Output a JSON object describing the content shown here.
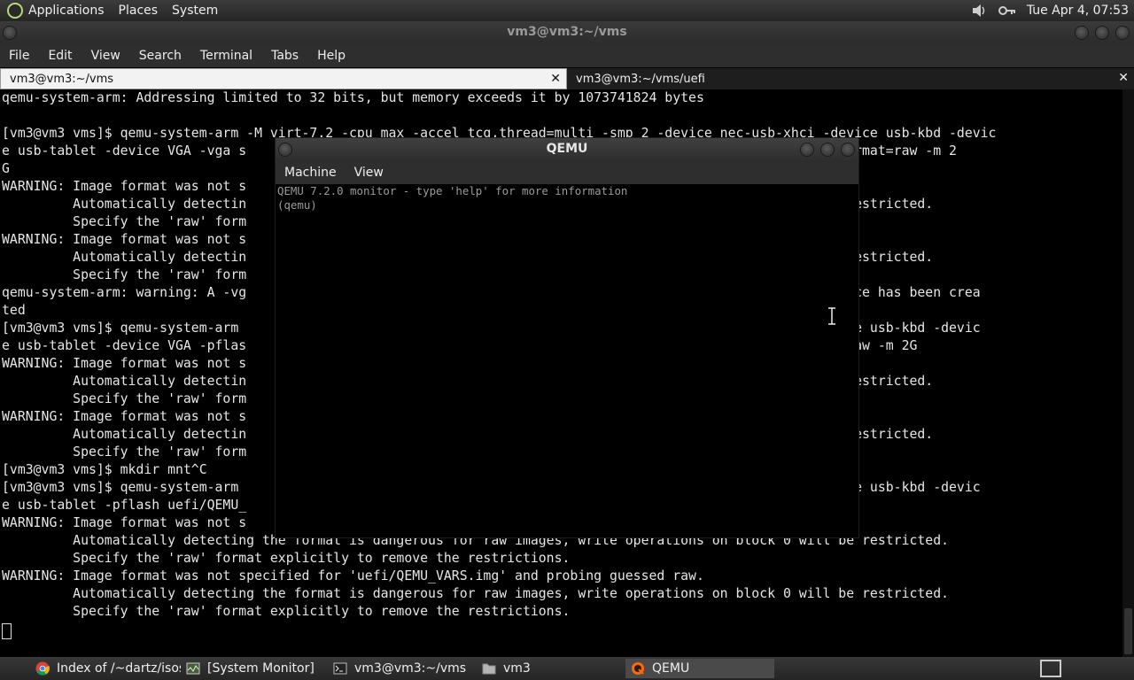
{
  "top_panel": {
    "menus": [
      "Applications",
      "Places",
      "System"
    ],
    "clock": "Tue Apr  4, 07:53",
    "tray_icons": [
      "volume-icon",
      "network-key-icon"
    ]
  },
  "terminal_window": {
    "title": "vm3@vm3:~/vms",
    "menus": [
      "File",
      "Edit",
      "View",
      "Search",
      "Terminal",
      "Tabs",
      "Help"
    ],
    "tabs": [
      {
        "label": "vm3@vm3:~/vms",
        "active": true
      },
      {
        "label": "vm3@vm3:~/vms/uefi",
        "active": false
      }
    ],
    "lines": [
      "qemu-system-arm: Addressing limited to 32 bits, but memory exceeds it by 1073741824 bytes",
      "",
      "[vm3@vm3 vms]$ qemu-system-arm -M virt-7.2 -cpu max -accel tcg,thread=multi -smp 2 -device nec-usb-xhci -device usb-kbd -devic",
      "e usb-tablet -device VGA -vga s                                                             e=gptdisk.img,format=raw -m 2",
      "G",
      "WARNING: Image format was not s",
      "         Automatically detectin                                                                k 0 will be restricted.",
      "         Specify the 'raw' form",
      "WARNING: Image format was not s",
      "         Automatically detectin                                                                k 0 will be restricted.",
      "         Specify the 'raw' form",
      "qemu-system-arm: warning: A -vg                                                                ; No VGA device has been crea",
      "ted",
      "[vm3@vm3 vms]$ qemu-system-arm                                                                 b-xhci -device usb-kbd -devic",
      "e usb-tablet -device VGA -pflas                                                                .img,format=raw -m 2G",
      "WARNING: Image format was not s",
      "         Automatically detectin                                                                k 0 will be restricted.",
      "         Specify the 'raw' form",
      "WARNING: Image format was not s",
      "         Automatically detectin                                                                k 0 will be restricted.",
      "         Specify the 'raw' form",
      "[vm3@vm3 vms]$ mkdir mnt^C",
      "[vm3@vm3 vms]$ qemu-system-arm                                                                 b-xhci -device usb-kbd -devic",
      "e usb-tablet -pflash uefi/QEMU_                                                                raw -m 2G",
      "WARNING: Image format was not s",
      "         Automatically detecting the format is dangerous for raw images, write operations on block 0 will be restricted.",
      "         Specify the 'raw' format explicitly to remove the restrictions.",
      "WARNING: Image format was not specified for 'uefi/QEMU_VARS.img' and probing guessed raw.",
      "         Automatically detecting the format is dangerous for raw images, write operations on block 0 will be restricted.",
      "         Specify the 'raw' format explicitly to remove the restrictions."
    ]
  },
  "qemu_window": {
    "title": "QEMU",
    "menus": [
      "Machine",
      "View"
    ],
    "console": [
      "QEMU 7.2.0 monitor - type 'help' for more information",
      "(qemu)"
    ]
  },
  "taskbar": {
    "tasks": [
      {
        "label": "Index of /~dartz/isos...",
        "icon": "chrome-icon",
        "active": false
      },
      {
        "label": "[System Monitor]",
        "icon": "system-monitor-icon",
        "active": false
      },
      {
        "label": "vm3@vm3:~/vms",
        "icon": "terminal-icon",
        "active": false
      },
      {
        "label": "vm3",
        "icon": "folder-icon",
        "active": false
      },
      {
        "label": "QEMU",
        "icon": "qemu-icon",
        "active": true
      }
    ]
  },
  "colors": {
    "terminal_bg": "#000000",
    "terminal_fg": "#e6e6e6",
    "panel_bg": "#2e2e2e",
    "active_tab_bg": "#f2f2f2"
  }
}
